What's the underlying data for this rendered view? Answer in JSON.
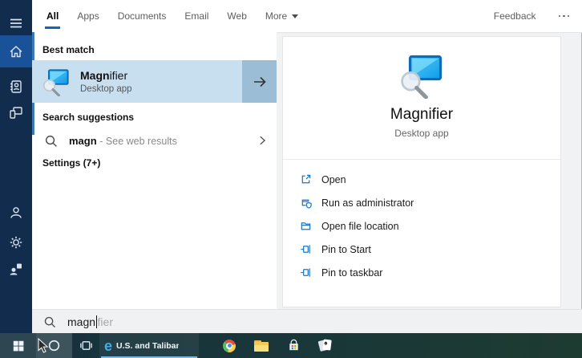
{
  "header": {
    "tabs": [
      {
        "label": "All",
        "active": true
      },
      {
        "label": "Apps",
        "active": false
      },
      {
        "label": "Documents",
        "active": false
      },
      {
        "label": "Email",
        "active": false
      },
      {
        "label": "Web",
        "active": false
      },
      {
        "label": "More",
        "active": false,
        "has_dropdown": true
      }
    ],
    "feedback_label": "Feedback",
    "overflow_icon": "more-options-icon"
  },
  "sidebar": {
    "items": [
      {
        "icon": "hamburger-icon"
      },
      {
        "icon": "home-icon",
        "selected": true
      },
      {
        "icon": "notebook-icon"
      },
      {
        "icon": "devices-icon"
      },
      {
        "icon": "person-icon"
      },
      {
        "icon": "gear-icon"
      },
      {
        "icon": "feedback-person-icon"
      }
    ]
  },
  "results": {
    "best_match": {
      "section_label": "Best match",
      "item": {
        "title_match": "Magn",
        "title_rest": "ifier",
        "subtitle": "Desktop app",
        "icon": "magnifier-app-icon",
        "expand_icon": "right-arrow-icon"
      }
    },
    "suggestions": {
      "section_label": "Search suggestions",
      "item": {
        "query": "magn",
        "hint": "- See web results",
        "icon": "search-icon",
        "chevron_icon": "chevron-right-icon"
      }
    },
    "settings_label": "Settings (7+)"
  },
  "preview": {
    "app_name": "Magnifier",
    "app_type": "Desktop app",
    "app_icon": "magnifier-app-icon",
    "actions": [
      {
        "label": "Open",
        "icon": "open-icon"
      },
      {
        "label": "Run as administrator",
        "icon": "run-admin-icon"
      },
      {
        "label": "Open file location",
        "icon": "open-file-location-icon"
      },
      {
        "label": "Pin to Start",
        "icon": "pin-icon"
      },
      {
        "label": "Pin to taskbar",
        "icon": "pin-icon"
      }
    ]
  },
  "search_box": {
    "typed": "magn",
    "completion": "fier",
    "icon": "search-icon"
  },
  "taskbar": {
    "edge_glyph": "e",
    "news_label": "U.S. and Taliban Agre...",
    "apps": [
      "start",
      "search",
      "task-view",
      "edge-news",
      "chrome",
      "file-explorer",
      "store",
      "solitaire"
    ]
  },
  "colors": {
    "rail_bg": "#122c4e",
    "rail_selected": "#1a529a",
    "tab_underline": "#1566b0",
    "best_match_bg": "#c8dff0",
    "arrow_box_bg": "#9cbdd6",
    "action_icon_blue": "#1976c5",
    "taskbar_underline": "#7ab8e8"
  }
}
